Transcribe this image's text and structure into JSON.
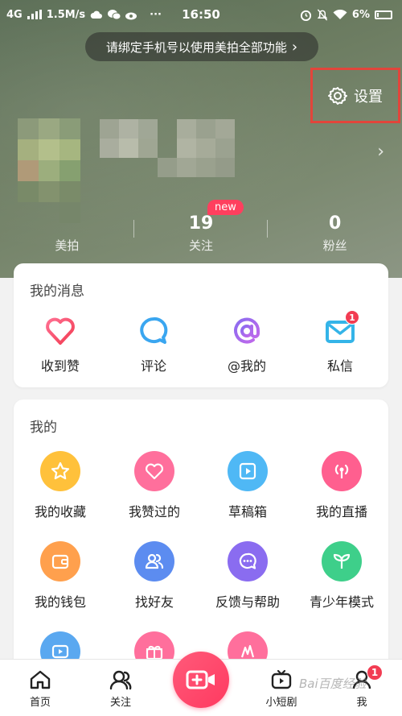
{
  "status_bar": {
    "network": "4G",
    "speed": "1.5M/s",
    "time": "16:50",
    "battery": "6%",
    "more": "···"
  },
  "bind_banner": {
    "text": "请绑定手机号以使用美拍全部功能",
    "chevron": "›"
  },
  "settings": {
    "label": "设置",
    "icon": "gear-icon"
  },
  "profile_chevron": "›",
  "stats": [
    {
      "num": "",
      "label": "美拍"
    },
    {
      "num": "19",
      "label": "关注",
      "badge": "new"
    },
    {
      "num": "0",
      "label": "粉丝"
    }
  ],
  "messages": {
    "title": "我的消息",
    "items": [
      {
        "label": "收到赞",
        "icon": "heart-outline-icon"
      },
      {
        "label": "评论",
        "icon": "comment-bubble-icon"
      },
      {
        "label": "@我的",
        "icon": "at-sign-icon"
      },
      {
        "label": "私信",
        "icon": "envelope-icon",
        "badge": "1"
      }
    ]
  },
  "mine": {
    "title": "我的",
    "items": [
      {
        "label": "我的收藏",
        "icon": "star-icon",
        "color": "#ffc13b"
      },
      {
        "label": "我赞过的",
        "icon": "heart-icon",
        "color": "#ff6f9c"
      },
      {
        "label": "草稿箱",
        "icon": "play-box-icon",
        "color": "#4fb8f5"
      },
      {
        "label": "我的直播",
        "icon": "broadcast-icon",
        "color": "#ff5f8f"
      },
      {
        "label": "我的钱包",
        "icon": "wallet-icon",
        "color": "#ffa04d"
      },
      {
        "label": "找好友",
        "icon": "friends-icon",
        "color": "#5c8cf0"
      },
      {
        "label": "反馈与帮助",
        "icon": "chat-dots-icon",
        "color": "#8a6cf0"
      },
      {
        "label": "青少年模式",
        "icon": "sprout-icon",
        "color": "#3ecf8a"
      }
    ],
    "partial": [
      {
        "icon": "tv-icon",
        "color": "#5aa8f0"
      },
      {
        "icon": "gift-icon",
        "color": "#ff6f9c"
      },
      {
        "icon": "pattern-icon",
        "color": "#ff6f9c"
      }
    ]
  },
  "bottom_nav": {
    "items": [
      {
        "label": "首页",
        "icon": "home-icon"
      },
      {
        "label": "关注",
        "icon": "follow-icon"
      },
      {
        "label": "小短剧",
        "icon": "tv-play-icon"
      },
      {
        "label": "我",
        "icon": "profile-icon",
        "badge": "1"
      }
    ],
    "record_icon": "video-add-icon"
  },
  "watermark": "Bai百度经验"
}
